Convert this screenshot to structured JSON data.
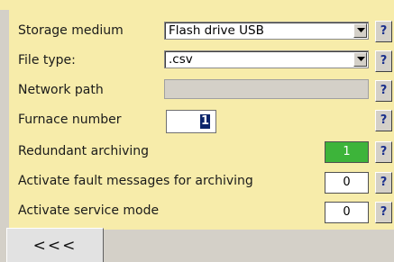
{
  "settings": {
    "storage_medium": {
      "label": "Storage medium",
      "value": "Flash drive USB",
      "help": "?"
    },
    "file_type": {
      "label": "File type:",
      "value": ".csv",
      "help": "?"
    },
    "network_path": {
      "label": "Network path",
      "value": "",
      "help": "?"
    },
    "furnace_number": {
      "label": "Furnace number",
      "value": "1",
      "help": "?"
    },
    "redundant_archiving": {
      "label": "Redundant archiving",
      "value": "1",
      "help": "?"
    },
    "fault_messages": {
      "label": "Activate fault messages for archiving",
      "value": "0",
      "help": "?"
    },
    "service_mode": {
      "label": "Activate service mode",
      "value": "0",
      "help": "?"
    }
  },
  "footer": {
    "back_label": "<<<"
  },
  "colors": {
    "panel_bg": "#f7ecaa",
    "window_bg": "#d4d0c8",
    "active_value": "#3db43a",
    "help_text": "#1a2f8c",
    "selection": "#0a246a"
  }
}
